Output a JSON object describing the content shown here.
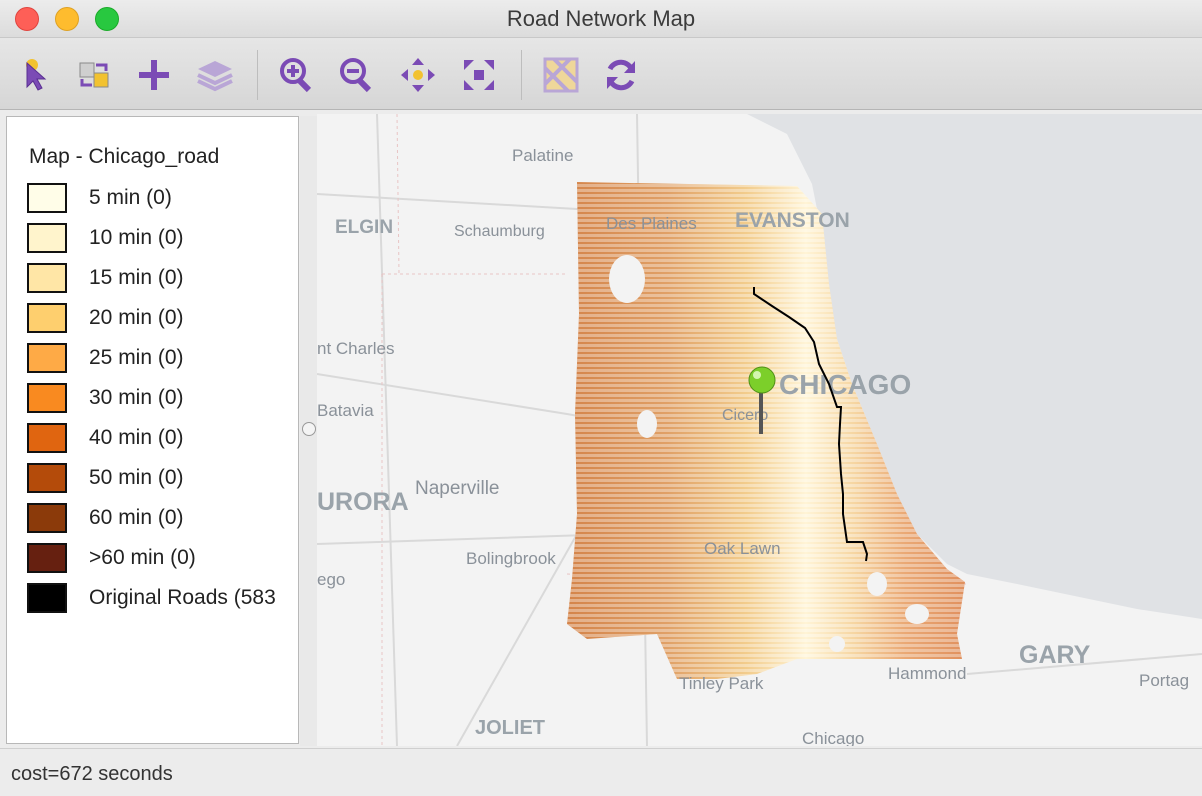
{
  "window": {
    "title": "Road Network Map"
  },
  "toolbar": {
    "tools": [
      {
        "name": "select-tool-icon"
      },
      {
        "name": "layer-select-icon"
      },
      {
        "name": "add-layer-icon"
      },
      {
        "name": "layers-icon"
      },
      {
        "name": "zoom-in-icon"
      },
      {
        "name": "zoom-out-icon"
      },
      {
        "name": "pan-icon"
      },
      {
        "name": "full-extent-icon"
      },
      {
        "name": "basemap-icon"
      },
      {
        "name": "refresh-icon"
      }
    ],
    "accent": "#7b4bb5"
  },
  "legend": {
    "title": "Map - Chicago_road",
    "items": [
      {
        "label": "5 min (0)",
        "color": "#fffde8"
      },
      {
        "label": "10 min (0)",
        "color": "#fff4cc"
      },
      {
        "label": "15 min (0)",
        "color": "#ffe6a6"
      },
      {
        "label": "20 min (0)",
        "color": "#fecf6e"
      },
      {
        "label": "25 min (0)",
        "color": "#feaa46"
      },
      {
        "label": "30 min (0)",
        "color": "#f98a20"
      },
      {
        "label": "40 min (0)",
        "color": "#e06510"
      },
      {
        "label": "50 min (0)",
        "color": "#b44b0a"
      },
      {
        "label": "60 min (0)",
        "color": "#8b3a0a"
      },
      {
        "label": ">60 min (0)",
        "color": "#662010"
      },
      {
        "label": "Original Roads (583",
        "color": "#000000"
      }
    ]
  },
  "map": {
    "labels": {
      "palatine": "Palatine",
      "elgin": "ELGIN",
      "schaumburg": "Schaumburg",
      "des_plaines": "Des Plaines",
      "evanston": "EVANSTON",
      "st_charles": "nt Charles",
      "chicago": "CHICAGO",
      "cicero": "Cicero",
      "batavia": "Batavia",
      "aurora": "URORA",
      "naperville": "Naperville",
      "bolingbrook": "Bolingbrook",
      "oswego": "ego",
      "oak_lawn": "Oak Lawn",
      "tinley_park": "Tinley Park",
      "hammond": "Hammond",
      "gary": "GARY",
      "portage": "Portag",
      "joliet": "JOLIET",
      "chicago_heights": "Chicago"
    },
    "lake_color": "#e0e2e5",
    "land_color": "#f3f3f3",
    "route_color": "#000000",
    "pin_color": "#7ccf2a"
  },
  "status": {
    "text": "cost=672 seconds"
  }
}
